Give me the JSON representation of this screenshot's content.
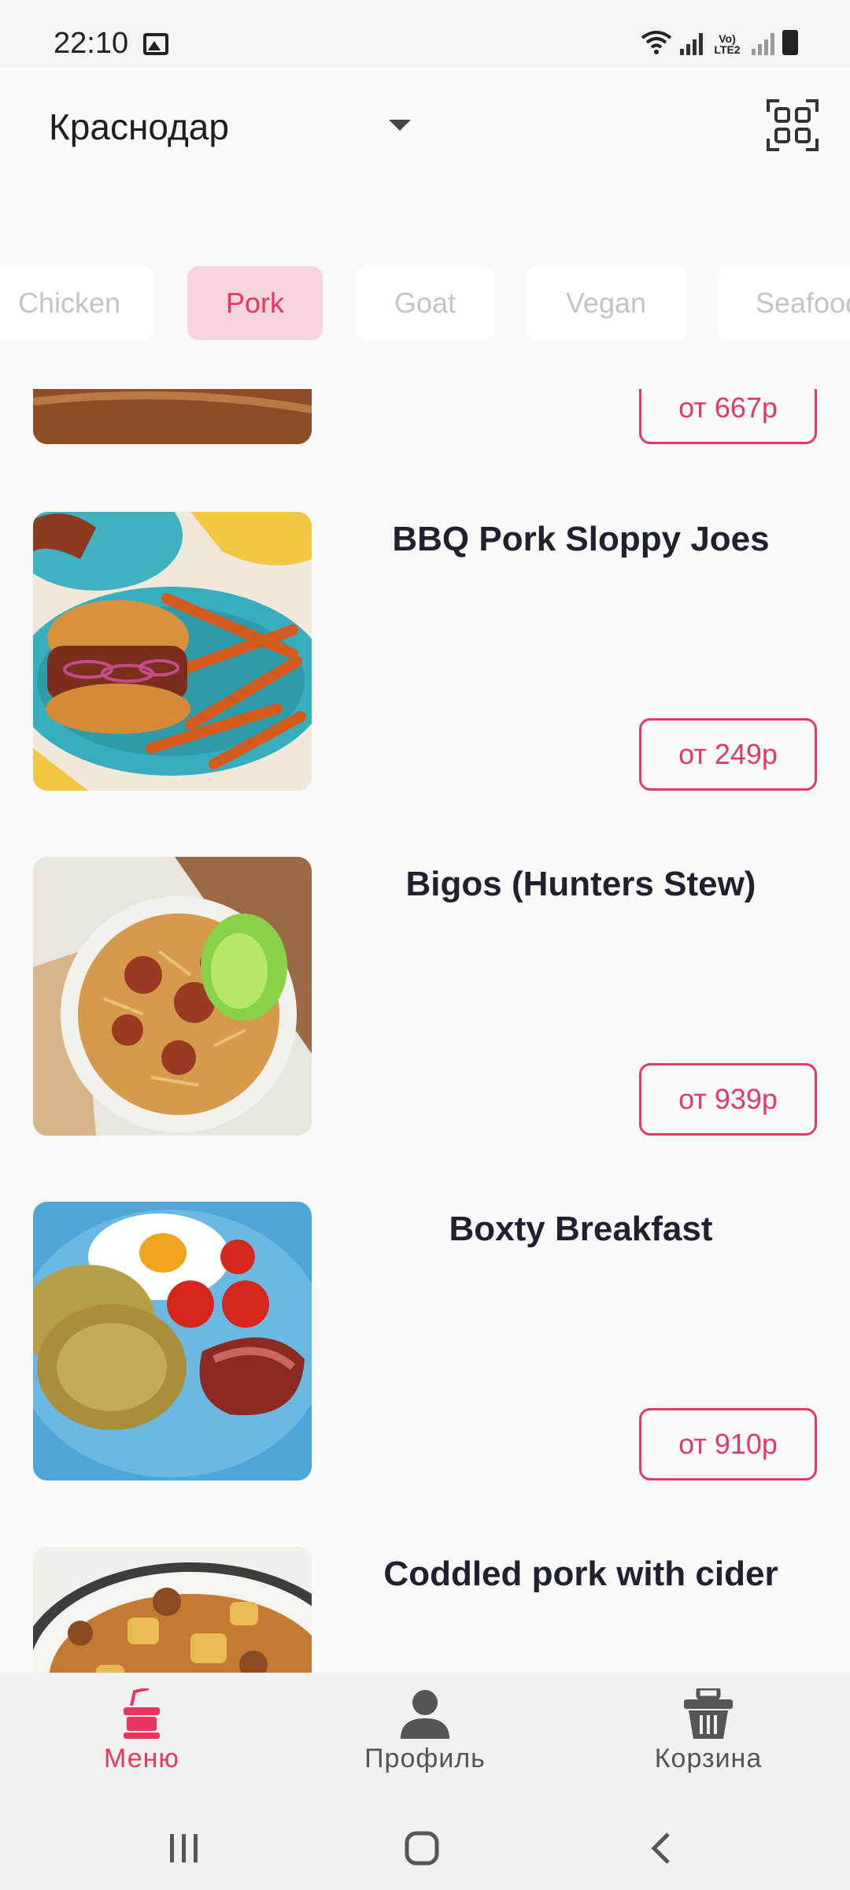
{
  "status_bar": {
    "time": "22:10",
    "network": "Vo) LTE2"
  },
  "header": {
    "city": "Краснодар"
  },
  "categories": [
    {
      "label": "Chicken",
      "active": false
    },
    {
      "label": "Pork",
      "active": true
    },
    {
      "label": "Goat",
      "active": false
    },
    {
      "label": "Vegan",
      "active": false
    },
    {
      "label": "Seafood",
      "active": false
    }
  ],
  "products": [
    {
      "title": "",
      "price": "от 667р"
    },
    {
      "title": "BBQ Pork Sloppy Joes",
      "price": "от 249р"
    },
    {
      "title": "Bigos (Hunters Stew)",
      "price": "от 939р"
    },
    {
      "title": "Boxty Breakfast",
      "price": "от 910р"
    },
    {
      "title": "Coddled pork with cider",
      "price": ""
    }
  ],
  "bottom_nav": [
    {
      "label": "Меню",
      "icon": "menu-drink-icon",
      "active": true
    },
    {
      "label": "Профиль",
      "icon": "person-icon",
      "active": false
    },
    {
      "label": "Корзина",
      "icon": "basket-icon",
      "active": false
    }
  ],
  "colors": {
    "accent": "#e8365f",
    "accent_bg": "#f8d4de",
    "text": "#1d2130"
  }
}
